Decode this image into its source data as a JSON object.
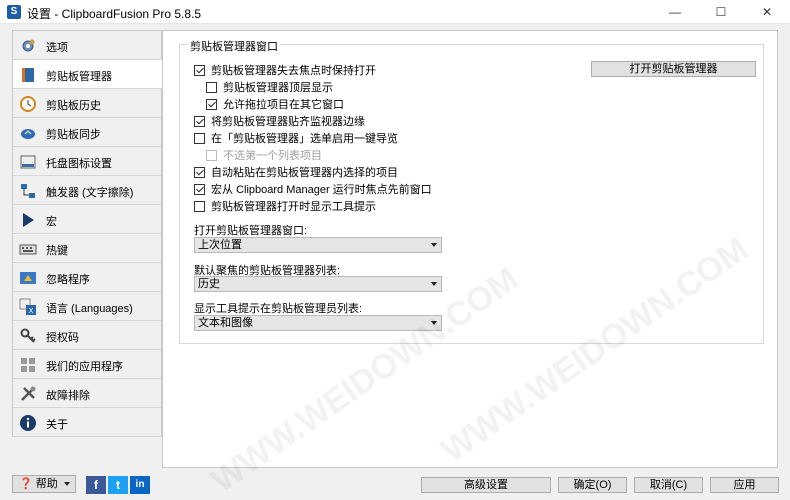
{
  "window": {
    "title": "设置 - ClipboardFusion Pro 5.8.5",
    "minimize": "—",
    "maximize": "☐",
    "close": "✕"
  },
  "sidebar": {
    "items": [
      {
        "label": "选项",
        "icon": "gear-icon"
      },
      {
        "label": "剪贴板管理器",
        "icon": "clipboard-book-icon"
      },
      {
        "label": "剪贴板历史",
        "icon": "clock-icon"
      },
      {
        "label": "剪贴板同步",
        "icon": "cloud-sync-icon"
      },
      {
        "label": "托盘图标设置",
        "icon": "tray-icon"
      },
      {
        "label": "触发器 (文字擦除)",
        "icon": "trigger-icon"
      },
      {
        "label": "宏",
        "icon": "play-icon"
      },
      {
        "label": "热键",
        "icon": "keyboard-icon"
      },
      {
        "label": "忽略程序",
        "icon": "ignore-program-icon"
      },
      {
        "label": "语言 (Languages)",
        "icon": "language-icon"
      },
      {
        "label": "授权码",
        "icon": "key-icon"
      },
      {
        "label": "我们的应用程序",
        "icon": "apps-grid-icon"
      },
      {
        "label": "故障排除",
        "icon": "tools-icon"
      },
      {
        "label": "关于",
        "icon": "info-icon"
      }
    ],
    "active_index": 1
  },
  "main": {
    "group_title": "剪贴板管理器窗口",
    "open_button": "打开剪贴板管理器",
    "options": [
      {
        "label": "剪贴板管理器失去焦点时保持打开",
        "checked": true,
        "enabled": true
      },
      {
        "label": "剪贴板管理器顶层显示",
        "checked": false,
        "enabled": true
      },
      {
        "label": "允许拖拉项目在其它窗口",
        "checked": true,
        "enabled": true
      },
      {
        "label": "将剪贴板管理器贴齐监视器边缘",
        "checked": true,
        "enabled": true
      },
      {
        "label": "在「剪贴板管理器」选单启用一键导览",
        "checked": false,
        "enabled": true
      },
      {
        "label": "不选第一个列表项目",
        "checked": false,
        "enabled": false
      },
      {
        "label": "自动粘贴在剪贴板管理器内选择的项目",
        "checked": true,
        "enabled": true
      },
      {
        "label": "宏从 Clipboard Manager 运行时焦点先前窗口",
        "checked": true,
        "enabled": true
      },
      {
        "label": "剪贴板管理器打开时显示工具提示",
        "checked": false,
        "enabled": true
      }
    ],
    "dropdowns": [
      {
        "label": "打开剪贴板管理器窗口:",
        "value": "上次位置"
      },
      {
        "label": "默认聚焦的剪贴板管理器列表:",
        "value": "历史"
      },
      {
        "label": "显示工具提示在剪贴板管理员列表:",
        "value": "文本和图像"
      }
    ]
  },
  "footer": {
    "help": "帮助",
    "advanced": "高级设置",
    "ok": "确定(O)",
    "cancel": "取消(C)",
    "apply": "应用",
    "social": [
      "f",
      "t",
      "in"
    ]
  },
  "watermark": "WWW.WEIDOWN.COM",
  "colors": {
    "facebook": "#3b5998",
    "twitter": "#1da1f2",
    "linkedin": "#0a66c2"
  }
}
